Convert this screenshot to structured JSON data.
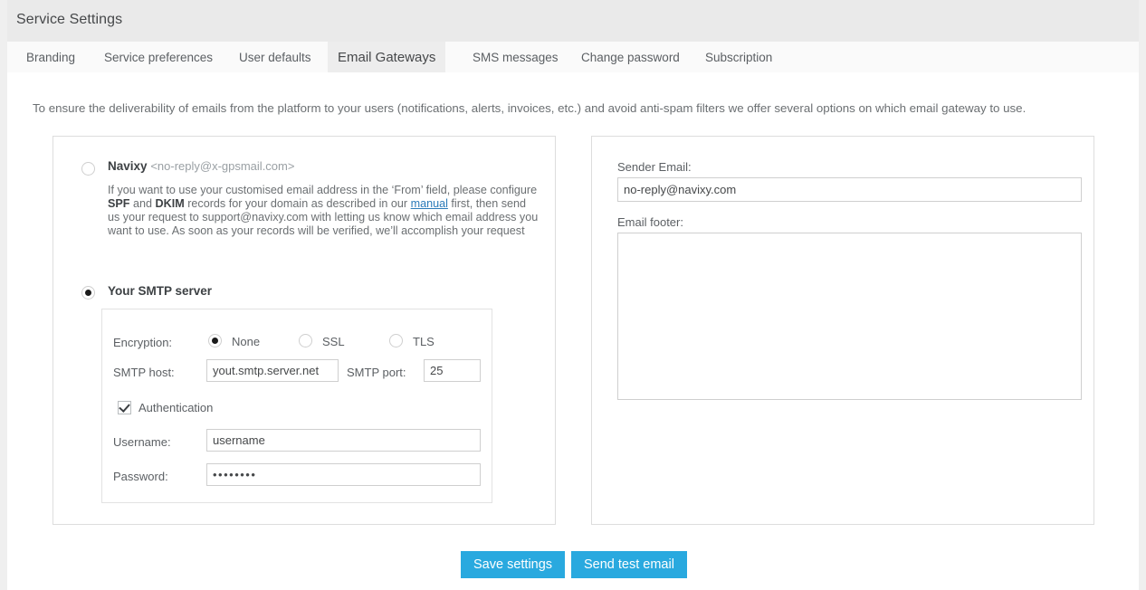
{
  "window": {
    "title": "Service Settings"
  },
  "tabs": [
    {
      "label": "Branding",
      "active": false
    },
    {
      "label": "Service preferences",
      "active": false
    },
    {
      "label": "User defaults",
      "active": false
    },
    {
      "label": "Email Gateways",
      "active": true
    },
    {
      "label": "SMS messages",
      "active": false
    },
    {
      "label": "Change password",
      "active": false
    },
    {
      "label": "Subscription",
      "active": false
    }
  ],
  "content": {
    "intro": "To ensure the deliverability of emails from the platform to your users (notifications, alerts, invoices, etc.) and avoid anti-spam filters we offer several options on which email gateway to use."
  },
  "gateway_options": {
    "navixy": {
      "label": "Navixy",
      "email": "<no-reply@x-gpsmail.com>",
      "selected": false,
      "description_part1": "If you want to use your customised email address in the ‘From’ field, please configure ",
      "bold1": "SPF",
      "description_part2": " and ",
      "bold2": "DKIM",
      "description_part3": " records for your domain as described in our ",
      "link": "manual",
      "description_part4": " first, then send us your request to support@navixy.com with letting us know which email address you want to use. As soon as your records will be verified, we’ll accomplish your request"
    },
    "smtp": {
      "label": "Your SMTP server",
      "selected": true,
      "encryption": {
        "label": "Encryption:",
        "options": [
          {
            "label": "None",
            "selected": true
          },
          {
            "label": "SSL",
            "selected": false
          },
          {
            "label": "TLS",
            "selected": false
          }
        ]
      },
      "host": {
        "label": "SMTP host:",
        "value": "yout.smtp.server.net"
      },
      "port": {
        "label": "SMTP port:",
        "value": "25"
      },
      "authentication": {
        "label": "Authentication",
        "checked": true
      },
      "username": {
        "label": "Username:",
        "value": "username"
      },
      "password": {
        "label": "Password:",
        "value": "••••••••"
      }
    }
  },
  "sender": {
    "email_label": "Sender Email:",
    "email_value": "no-reply@navixy.com",
    "footer_label": "Email footer:",
    "footer_value": ""
  },
  "actions": {
    "save_label": "Save settings",
    "test_label": "Send test email"
  },
  "colors": {
    "accent": "#29a9df",
    "header_bg": "#eaeaea",
    "tab_bg": "#fafafa",
    "active_tab_bg": "#ededed",
    "link": "#2b7bb9"
  }
}
